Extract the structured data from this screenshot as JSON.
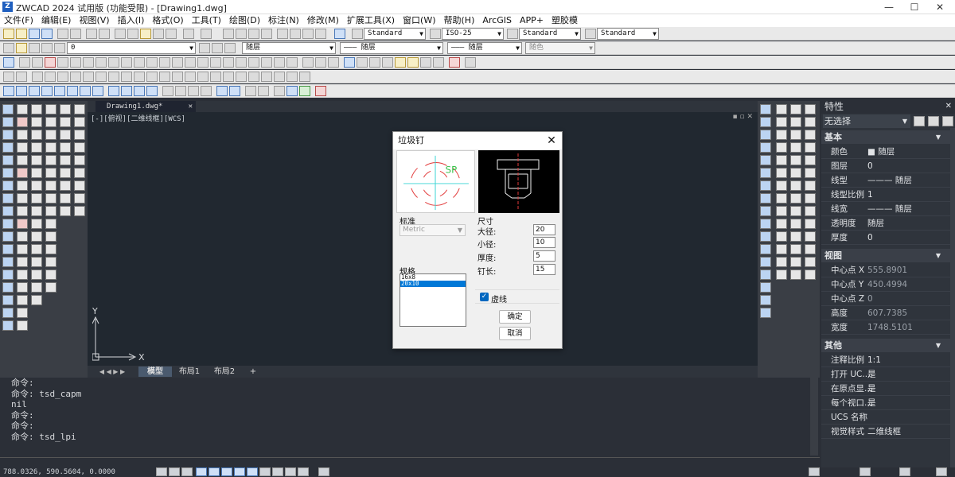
{
  "window": {
    "title": "ZWCAD 2024 试用版 (功能受限) - [Drawing1.dwg]",
    "icon_text": "Z",
    "minimize": "—",
    "maximize": "☐",
    "close": "✕"
  },
  "menu": [
    "文件(F)",
    "编辑(E)",
    "视图(V)",
    "插入(I)",
    "格式(O)",
    "工具(T)",
    "绘图(D)",
    "标注(N)",
    "修改(M)",
    "扩展工具(X)",
    "窗口(W)",
    "帮助(H)",
    "ArcGIS",
    "APP+",
    "塑胶模"
  ],
  "toolbar": {
    "text_style": "Standard",
    "dim_style": "ISO-25",
    "table_style": "Standard",
    "multileader_style": "Standard",
    "layer": "0",
    "color": "随层",
    "linetype": "——— 随层",
    "lineweight": "——— 随层",
    "plotstyle": "随色"
  },
  "document": {
    "tab_title": "Drawing1.dwg*",
    "view_label": "[-][俯视][二维线框][WCS]",
    "ucs_y": "Y",
    "ucs_x": "X",
    "vp_ctrls": "▪ ▫ ✕"
  },
  "layout_tabs": {
    "nav": "◀ ◀ ▶ ▶",
    "model": "模型",
    "layout1": "布局1",
    "layout2": "布局2",
    "add": "+"
  },
  "command_history": [
    "命令:",
    "命令: tsd_capm",
    "nil",
    "命令:",
    "命令:",
    "命令: tsd_lpi"
  ],
  "status": {
    "coords": "788.0326, 590.5604, 0.0000"
  },
  "properties": {
    "title": "特性",
    "close": "✕",
    "selection": "无选择",
    "sections": {
      "basic": "基本",
      "view": "视图",
      "misc": "其他"
    },
    "basic": [
      {
        "key": "颜色",
        "value": "■ 随层"
      },
      {
        "key": "图层",
        "value": "0"
      },
      {
        "key": "线型",
        "value": "——— 随层"
      },
      {
        "key": "线型比例",
        "value": "1"
      },
      {
        "key": "线宽",
        "value": "——— 随层"
      },
      {
        "key": "透明度",
        "value": "随层"
      },
      {
        "key": "厚度",
        "value": "0"
      }
    ],
    "view": [
      {
        "key": "中心点 X",
        "value": "555.8901"
      },
      {
        "key": "中心点 Y",
        "value": "450.4994"
      },
      {
        "key": "中心点 Z",
        "value": "0"
      },
      {
        "key": "高度",
        "value": "607.7385"
      },
      {
        "key": "宽度",
        "value": "1748.5101"
      }
    ],
    "misc": [
      {
        "key": "注释比例",
        "value": "1:1"
      },
      {
        "key": "打开 UC...",
        "value": "是"
      },
      {
        "key": "在原点显...",
        "value": "是"
      },
      {
        "key": "每个视口...",
        "value": "是"
      },
      {
        "key": "UCS 名称",
        "value": ""
      },
      {
        "key": "视觉样式",
        "value": "二维线框"
      }
    ]
  },
  "dialog": {
    "title": "垃圾钉",
    "close": "✕",
    "preview_text": "SP",
    "standard_label": "标准",
    "standard_value": "Metric",
    "spec_label": "规格",
    "specs": [
      "16x8",
      "20x10"
    ],
    "selected_spec": "20x10",
    "size_label": "尺寸",
    "fields": [
      {
        "label": "大径:",
        "value": "20"
      },
      {
        "label": "小径:",
        "value": "10"
      },
      {
        "label": "厚度:",
        "value": "5"
      },
      {
        "label": "钉长:",
        "value": "15"
      }
    ],
    "dashed_label": "虚线",
    "dashed_checked": true,
    "ok": "确定",
    "cancel": "取消"
  }
}
